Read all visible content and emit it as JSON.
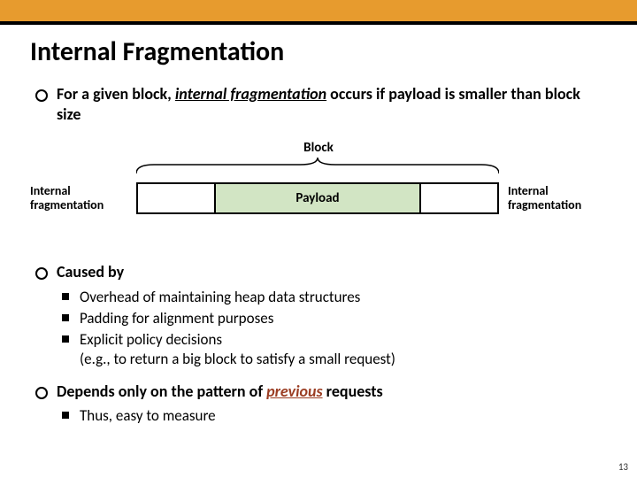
{
  "title": "Internal Fragmentation",
  "bullets": {
    "b1": {
      "pre": "For a given block, ",
      "em": "internal fragmentation",
      "post": " occurs if payload is smaller than block size"
    },
    "b2": {
      "text": "Caused by"
    },
    "b2subs": {
      "s1": "Overhead of maintaining heap data structures",
      "s2": "Padding for alignment purposes",
      "s3a": "Explicit policy decisions",
      "s3b": "(e.g., to return a big block to satisfy a small request)"
    },
    "b3": {
      "pre": "Depends only on the pattern of ",
      "em": "previous",
      "post": " requests"
    },
    "b3subs": {
      "s1": "Thus, easy to measure"
    }
  },
  "diagram": {
    "block_label": "Block",
    "left_label": "Internal fragmentation",
    "payload": "Payload",
    "right_label": "Internal fragmentation"
  },
  "page": "13"
}
